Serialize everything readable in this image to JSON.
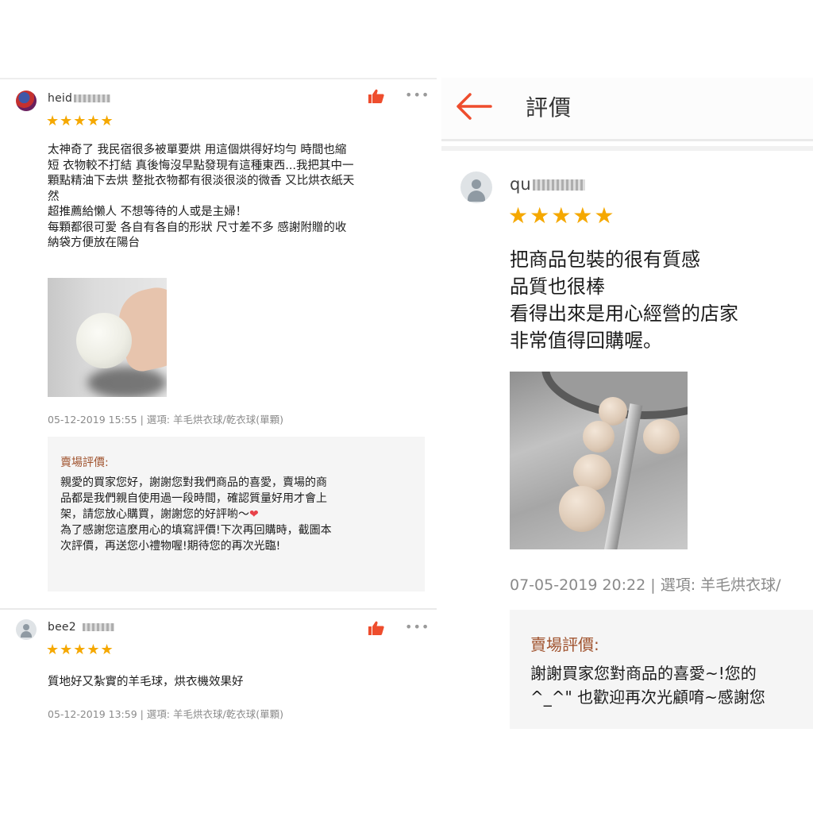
{
  "left": {
    "reviews": [
      {
        "username": "heid",
        "stars": "★★★★★",
        "text": "太神奇了 我民宿很多被單要烘 用這個烘得好均勻 時間也縮\n短 衣物較不打結 真後悔沒早點發現有這種東西...我把其中一\n顆點精油下去烘 整批衣物都有很淡很淡的微香 又比烘衣紙天\n然\n超推薦給懶人 不想等待的人或是主婦！\n每顆都很可愛 各自有各自的形狀 尺寸差不多 感謝附贈的收\n納袋方便放在陽台",
        "meta": "05-12-2019 15:55 | 選項: 羊毛烘衣球/乾衣球(單顆)",
        "more": "•••",
        "seller_title": "賣場評價:",
        "seller_text": "親愛的買家您好，謝謝您對我們商品的喜愛，賣場的商\n品都是我們親自使用過一段時間，確認質量好用才會上\n架，請您放心購買，謝謝您的好評喲～",
        "seller_heart": "❤",
        "seller_text2": "為了感謝您這麼用心的填寫評價!下次再回購時，截圖本\n次評價，再送您小禮物喔!期待您的再次光臨!"
      },
      {
        "username": "bee2",
        "stars": "★★★★★",
        "text": "質地好又紮實的羊毛球，烘衣機效果好",
        "meta": "05-12-2019 13:59 | 選項: 羊毛烘衣球/乾衣球(單顆)",
        "more": "•••"
      }
    ]
  },
  "right": {
    "title": "評價",
    "username": "qu",
    "stars": "★★★★★",
    "text": "把商品包裝的很有質感\n品質也很棒\n看得出來是用心經營的店家\n非常值得回購喔。",
    "meta": "07-05-2019 20:22 | 選項: 羊毛烘衣球/",
    "seller_title": "賣場評價:",
    "seller_text": "謝謝買家您對商品的喜愛~!您的\n^_^\" 也歡迎再次光顧唷~感謝您"
  },
  "colors": {
    "accent": "#ee4d2d",
    "star": "#f5a800",
    "seller_title": "#a0522d",
    "meta": "#8a8a8a"
  },
  "icons": [
    "thumbs-up-icon",
    "more-icon",
    "back-arrow-icon",
    "user-avatar-icon"
  ]
}
